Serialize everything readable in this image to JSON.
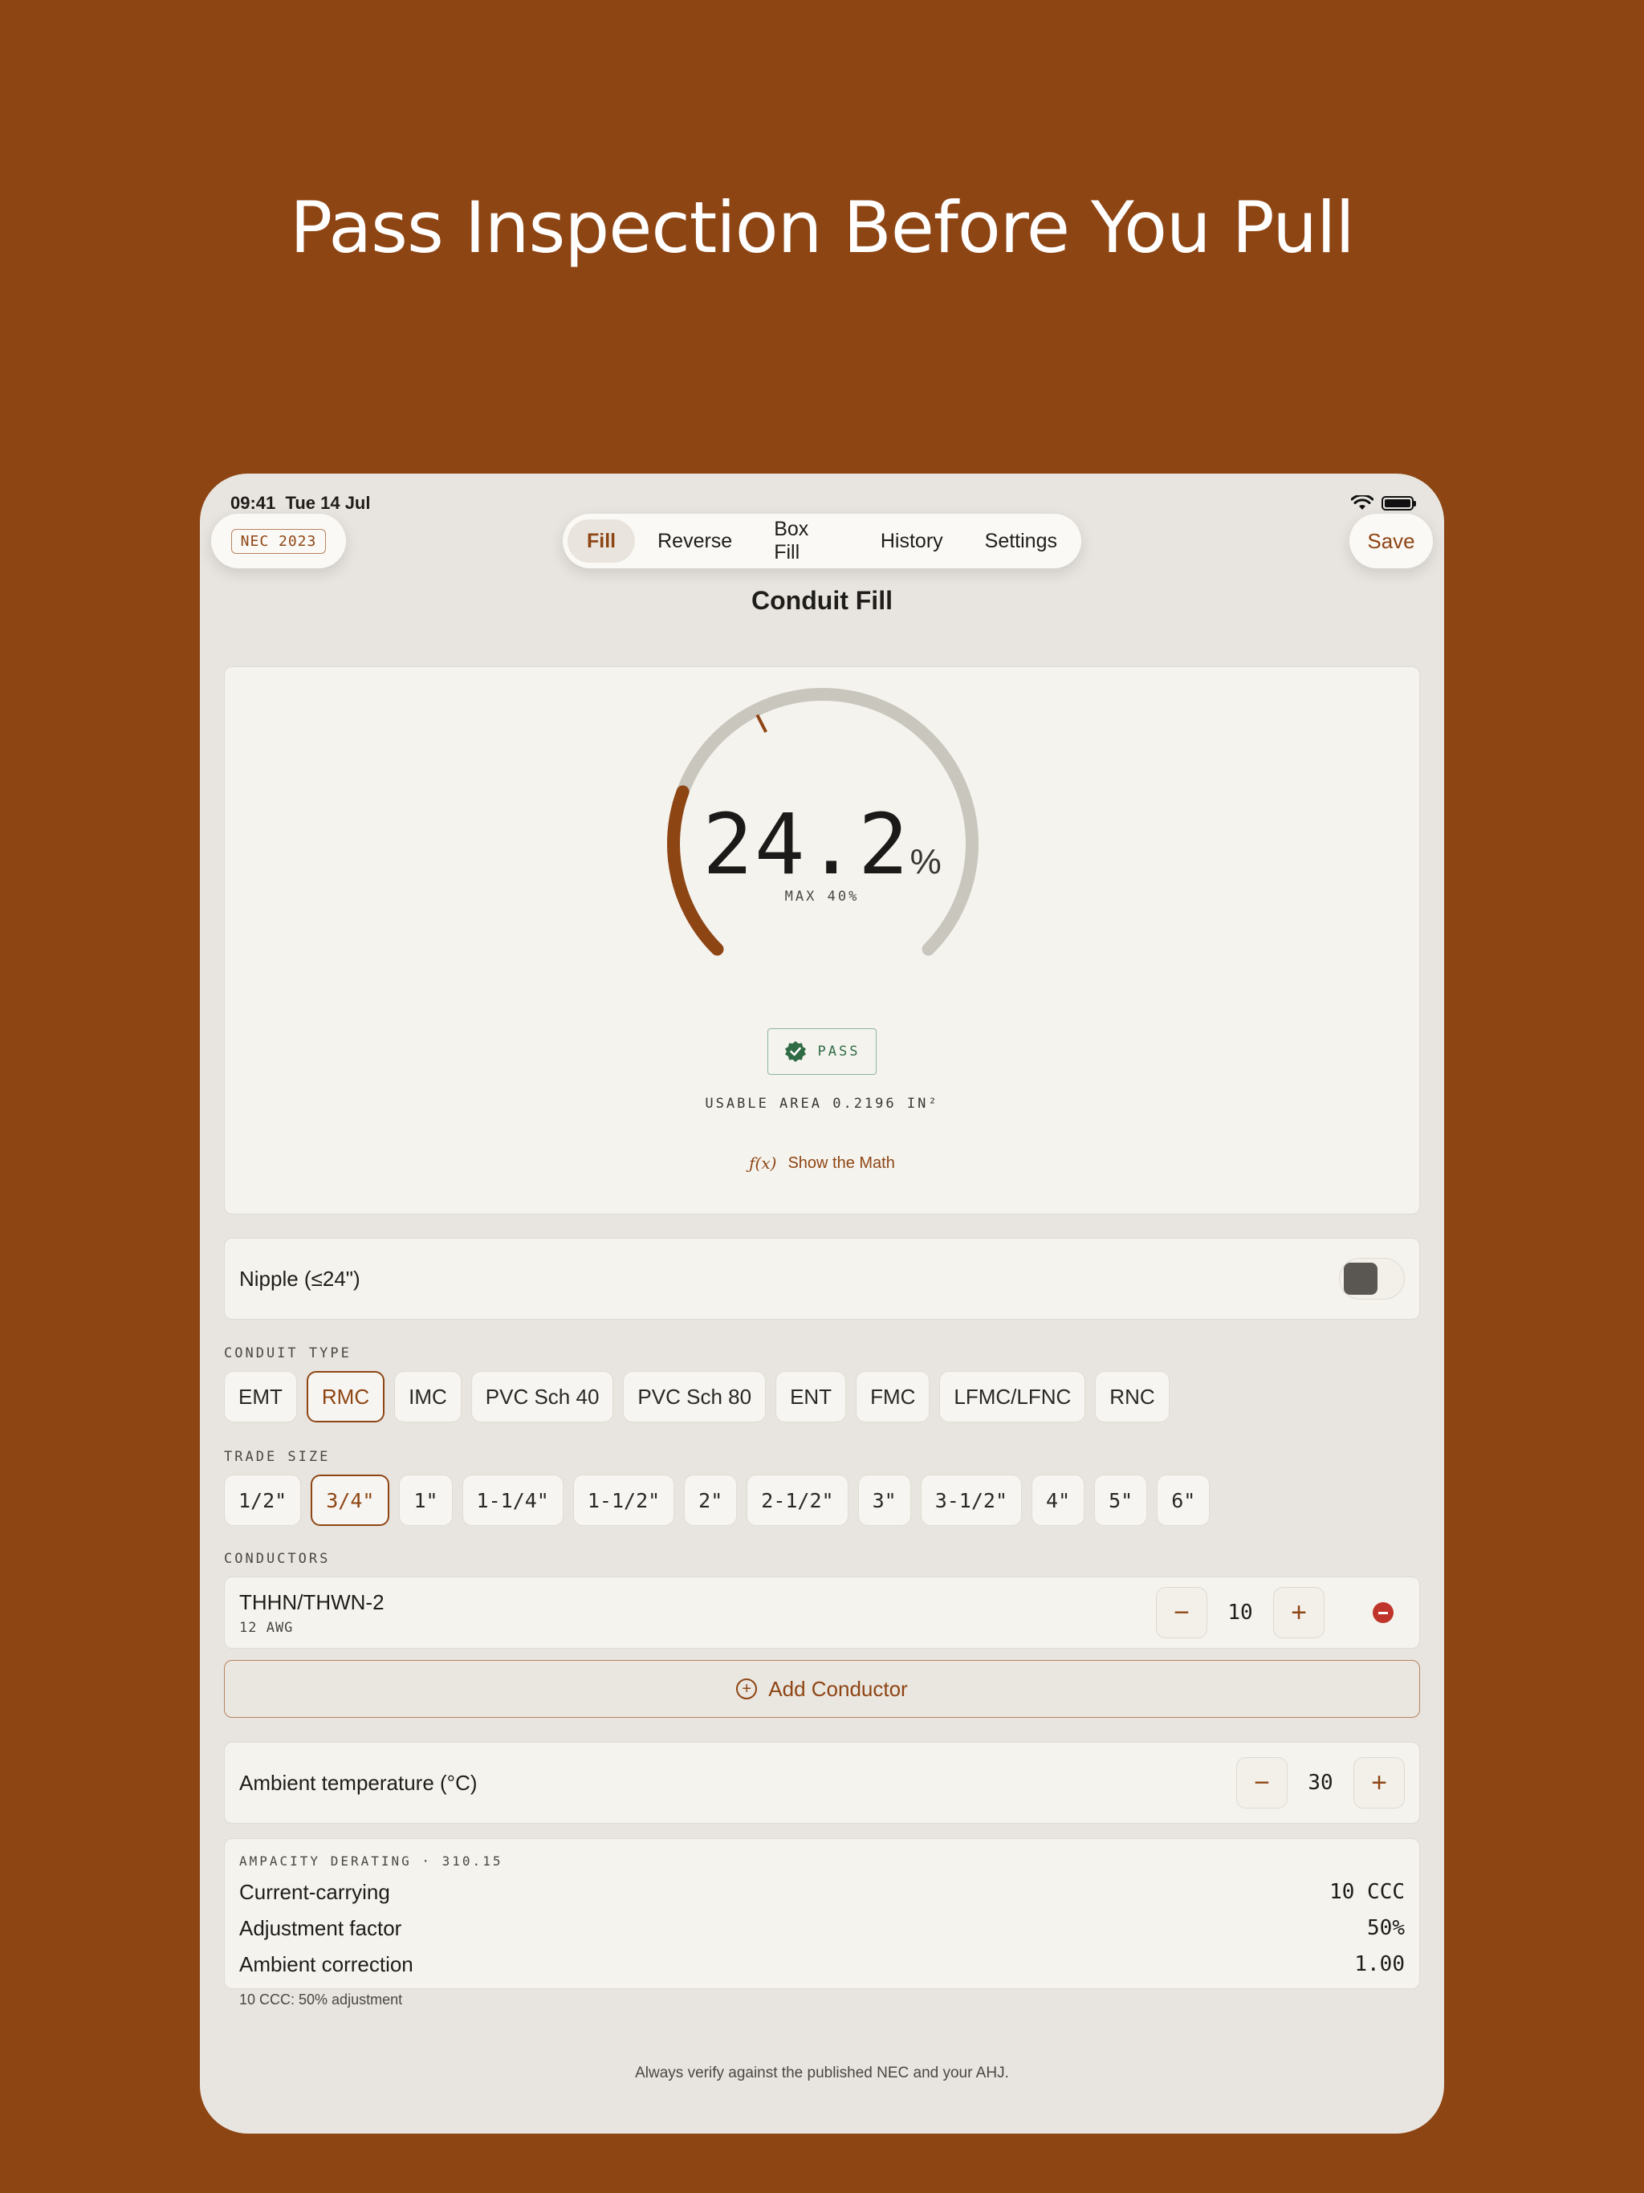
{
  "headline": "Pass Inspection Before You Pull",
  "status_bar": {
    "time": "09:41",
    "date": "Tue 14 Jul"
  },
  "nec_edition": "NEC 2023",
  "tabs": [
    {
      "label": "Fill",
      "active": true
    },
    {
      "label": "Reverse",
      "active": false
    },
    {
      "label": "Box Fill",
      "active": false
    },
    {
      "label": "History",
      "active": false
    },
    {
      "label": "Settings",
      "active": false
    }
  ],
  "save_label": "Save",
  "screen_title": "Conduit Fill",
  "gauge": {
    "value": "24.2",
    "unit": "%",
    "max_label": "MAX 40%",
    "fill_percent": 24.2,
    "max_percent": 40,
    "fill_color": "#8E4514",
    "track_color": "#C9C6BE"
  },
  "status_badge": "PASS",
  "usable_area": "USABLE AREA 0.2196 IN²",
  "show_math": {
    "icon": "ƒ(x)",
    "label": "Show the Math"
  },
  "nipple": {
    "label": "Nipple (≤24\")",
    "enabled": false
  },
  "conduit_type": {
    "label": "CONDUIT TYPE",
    "options": [
      "EMT",
      "RMC",
      "IMC",
      "PVC Sch 40",
      "PVC Sch 80",
      "ENT",
      "FMC",
      "LFMC/LFNC",
      "RNC"
    ],
    "selected": "RMC"
  },
  "trade_size": {
    "label": "TRADE SIZE",
    "options": [
      "1/2\"",
      "3/4\"",
      "1\"",
      "1-1/4\"",
      "1-1/2\"",
      "2\"",
      "2-1/2\"",
      "3\"",
      "3-1/2\"",
      "4\"",
      "5\"",
      "6\""
    ],
    "selected": "3/4\""
  },
  "conductors": {
    "label": "CONDUCTORS",
    "items": [
      {
        "type": "THHN/THWN-2",
        "size": "12 AWG",
        "count": "10"
      }
    ],
    "add_label": "Add Conductor"
  },
  "ambient": {
    "label": "Ambient temperature (°C)",
    "value": "30"
  },
  "derating": {
    "heading": "AMPACITY DERATING · 310.15",
    "rows": [
      {
        "label": "Current-carrying",
        "value": "10 CCC"
      },
      {
        "label": "Adjustment factor",
        "value": "50%"
      },
      {
        "label": "Ambient correction",
        "value": "1.00"
      }
    ],
    "note": "10 CCC: 50% adjustment"
  },
  "disclaimer": "Always verify against the published NEC and your AHJ.",
  "accent_color": "#8E4514",
  "pass_color": "#2F6B45",
  "remove_color": "#C0352B"
}
